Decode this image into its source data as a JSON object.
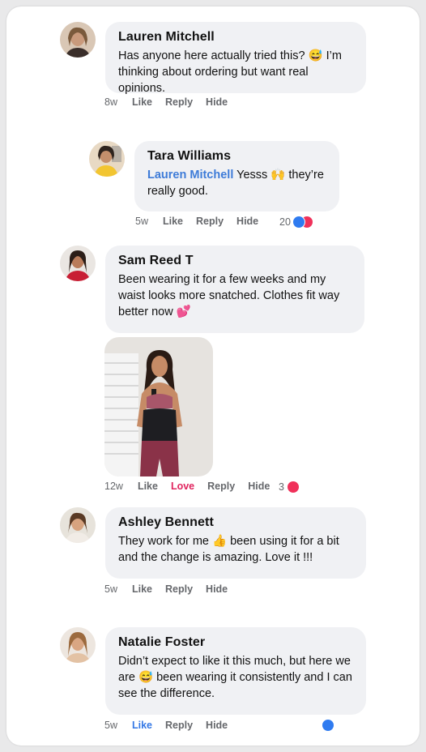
{
  "comments": [
    {
      "name": "Lauren Mitchell",
      "text": " Has anyone here actually tried this? 😅 I’m thinking about ordering but want real opinions.",
      "time": "8w",
      "like": "Like",
      "reply": "Reply",
      "hide": "Hide"
    },
    {
      "name": "Tara Williams",
      "mention": "Lauren Mitchell",
      "text": " Yesss 🙌 they’re really good.",
      "time": "5w",
      "like": "Like",
      "reply": "Reply",
      "hide": "Hide",
      "reactions": "20"
    },
    {
      "name": "Sam Reed T",
      "text": "Been wearing it for a few weeks and my waist looks more snatched. Clothes fit way better now 💕",
      "time": "12w",
      "like": "Like",
      "love": "Love",
      "reply": "Reply",
      "hide": "Hide",
      "reactions": "3"
    },
    {
      "name": "Ashley Bennett",
      "text": "They work for me 👍 been using it for a bit and the change is amazing. Love it !!!",
      "time": "5w",
      "like": "Like",
      "reply": "Reply",
      "hide": "Hide"
    },
    {
      "name": "Natalie Foster",
      "text": "Didn’t expect to like it this much, but here we are 😅 been wearing it consistently and I can see the difference.",
      "time": "5w",
      "like": "Like",
      "reply": "Reply",
      "hide": "Hide"
    }
  ],
  "colors": {
    "bubble": "#f0f1f4",
    "mention": "#3d7bd8",
    "love": "#e0245e",
    "like_active": "#3578e5"
  },
  "icons": [
    "like-reaction-icon",
    "love-reaction-icon"
  ]
}
